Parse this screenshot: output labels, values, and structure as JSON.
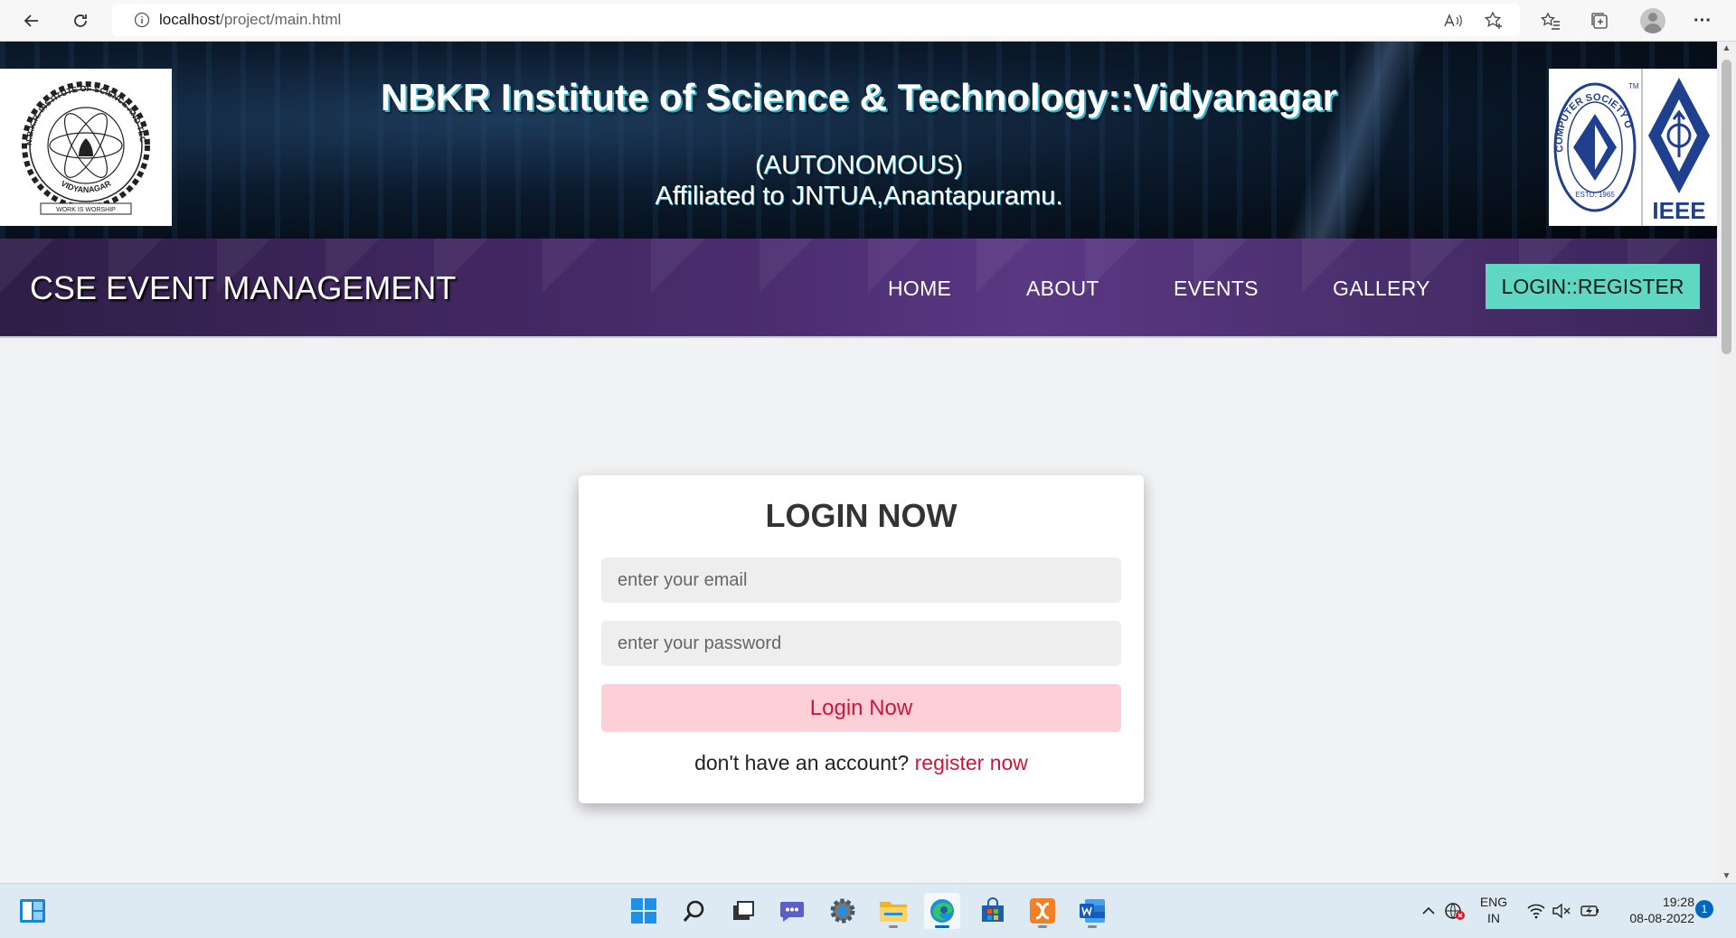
{
  "browser": {
    "url_host": "localhost",
    "url_path": "/project/main.html"
  },
  "header": {
    "title": "NBKR Institute of Science & Technology::Vidyanagar",
    "autonomous": "(AUTONOMOUS)",
    "affiliation": "Affiliated to JNTUA,Anantapuramu.",
    "left_logo": {
      "top_arc": "N.B.K.R. INSTITUTE OF SCIENCE AND TECHNOLOGY",
      "bottom_arc": "VIDYANAGAR",
      "motto": "WORK IS WORSHIP"
    },
    "right_logo": {
      "csi_text": "COMPUTER SOCIETY OF INDIA",
      "csi_est": "ESTD. 1965",
      "csi_tm": "TM",
      "ieee_text": "IEEE"
    }
  },
  "navbar": {
    "brand": "CSE EVENT MANAGEMENT",
    "links": [
      "HOME",
      "ABOUT",
      "EVENTS",
      "GALLERY"
    ],
    "cta": "LOGIN::REGISTER"
  },
  "login": {
    "title": "LOGIN NOW",
    "email_placeholder": "enter your email",
    "password_placeholder": "enter your password",
    "submit": "Login Now",
    "footer_text": "don't have an account?",
    "register_link": "register now"
  },
  "taskbar": {
    "language": "ENG",
    "region": "IN",
    "time": "19:28",
    "date": "08-08-2022",
    "notifications": "1",
    "icons": [
      "widgets-icon",
      "start-icon",
      "search-icon",
      "task-view-icon",
      "chat-icon",
      "settings-icon",
      "file-explorer-icon",
      "edge-icon",
      "store-icon",
      "xampp-icon",
      "word-icon"
    ]
  },
  "colors": {
    "accent_cta": "#5fd8c3",
    "login_button_bg": "#fdd0d8",
    "login_button_text": "#d0153b",
    "navbar": "#4b2d70"
  }
}
